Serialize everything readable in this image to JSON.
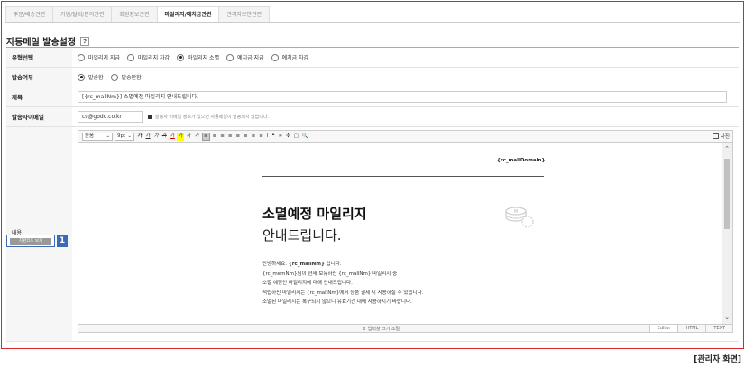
{
  "tabs": [
    {
      "label": "주문/배송관련",
      "active": false
    },
    {
      "label": "가입/탈퇴/문의관련",
      "active": false
    },
    {
      "label": "회원정보관련",
      "active": false
    },
    {
      "label": "마일리지/예치금관련",
      "active": true
    },
    {
      "label": "관리자보안관련",
      "active": false
    }
  ],
  "section_title": "자동메일 발송설정",
  "help_symbol": "?",
  "form": {
    "type": {
      "label": "유형선택",
      "options": [
        {
          "label": "마일리지 지급",
          "checked": false
        },
        {
          "label": "마일리지 차감",
          "checked": false
        },
        {
          "label": "마일리지 소멸",
          "checked": true
        },
        {
          "label": "예치금 지급",
          "checked": false
        },
        {
          "label": "예치금 차감",
          "checked": false
        }
      ]
    },
    "send": {
      "label": "발송여부",
      "options": [
        {
          "label": "발송함",
          "checked": true
        },
        {
          "label": "발송안함",
          "checked": false
        }
      ]
    },
    "subject": {
      "label": "제목",
      "value": "[{rc_mallNm}] 소멸예정 마일리지 안내드립니다."
    },
    "sender": {
      "label": "발송자이메일",
      "value": "cs@godo.co.kr",
      "note": "발송자 이메일 정보가 없으면 자동메일이 발송되지 않습니다."
    },
    "content": {
      "label": "내용",
      "html_button": "치환코드 보기",
      "badge": "1"
    }
  },
  "toolbar": {
    "font_select": "돋움",
    "size_select": "9pt",
    "buttons": [
      "가",
      "가",
      "가",
      "가",
      "가",
      "가",
      "가",
      "가"
    ],
    "extra_buttons": [
      "≡",
      "≡",
      "≡",
      "≡",
      "≡",
      "≡",
      "≡",
      "≡",
      "I",
      "❝",
      "∞",
      "✣",
      "▢",
      "🔍"
    ],
    "photo_label": "사진"
  },
  "email": {
    "domain": "{rc_mallDomain}",
    "heading1": "소멸예정 마일리지",
    "heading2": "안내드립니다.",
    "greeting_prefix": "안녕하세요.",
    "greeting_name": "{rc_mallNm}",
    "greeting_suffix": "입니다.",
    "line2": "{rc_memNm}님이 현재 보유하신 {rc_mallNm} 마일리지 중",
    "line3": "소멸 예정인 마일리지에 대해 안내드립니다.",
    "line4": "적립하신 마일리지는 {rc_mallNm}에서 상품 결제 시 사용하실 수 있습니다.",
    "line5": "소멸된 마일리지는 복구되지 않으니 유효기간 내에 사용하시기 바랍니다."
  },
  "status_bar": {
    "resize_label": "⇕ 입력창 크기 조절",
    "modes": [
      "Editor",
      "HTML",
      "TEXT"
    ]
  },
  "caption": "[관리자 화면]"
}
